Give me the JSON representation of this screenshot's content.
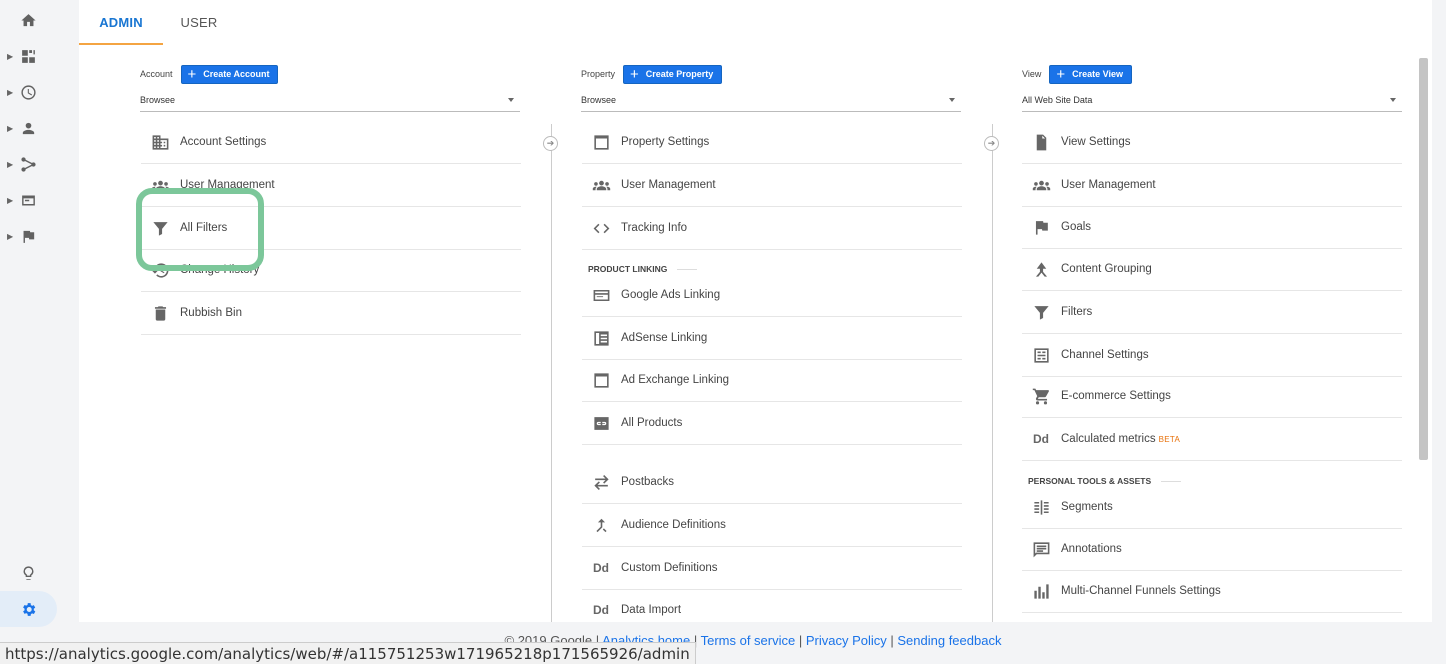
{
  "tabs": {
    "admin": "ADMIN",
    "user": "USER"
  },
  "columns": {
    "account": {
      "label": "Account",
      "create": "Create Account",
      "select": "Browsee",
      "items": [
        "Account Settings",
        "User Management",
        "All Filters",
        "Change History",
        "Rubbish Bin"
      ]
    },
    "property": {
      "label": "Property",
      "create": "Create Property",
      "select": "Browsee",
      "items": [
        "Property Settings",
        "User Management",
        "Tracking Info"
      ],
      "section": "PRODUCT LINKING",
      "linking": [
        "Google Ads Linking",
        "AdSense Linking",
        "Ad Exchange Linking",
        "All Products"
      ],
      "more": [
        "Postbacks",
        "Audience Definitions",
        "Custom Definitions",
        "Data Import"
      ]
    },
    "view": {
      "label": "View",
      "create": "Create View",
      "select": "All Web Site Data",
      "items": [
        "View Settings",
        "User Management",
        "Goals",
        "Content Grouping",
        "Filters",
        "Channel Settings",
        "E-commerce Settings",
        "Calculated metrics"
      ],
      "beta": "BETA",
      "section": "PERSONAL TOOLS & ASSETS",
      "tools": [
        "Segments",
        "Annotations",
        "Multi-Channel Funnels Settings"
      ]
    }
  },
  "footer": {
    "copyright": "© 2019 Google |",
    "links": [
      "Analytics home",
      "Terms of service",
      "Privacy Policy",
      "Sending feedback"
    ]
  },
  "statusbar": "https://analytics.google.com/analytics/web/#/a115751253w171965218p171565926/admin",
  "accent": "#1a73e8",
  "highlight_color": "#7cc79a"
}
